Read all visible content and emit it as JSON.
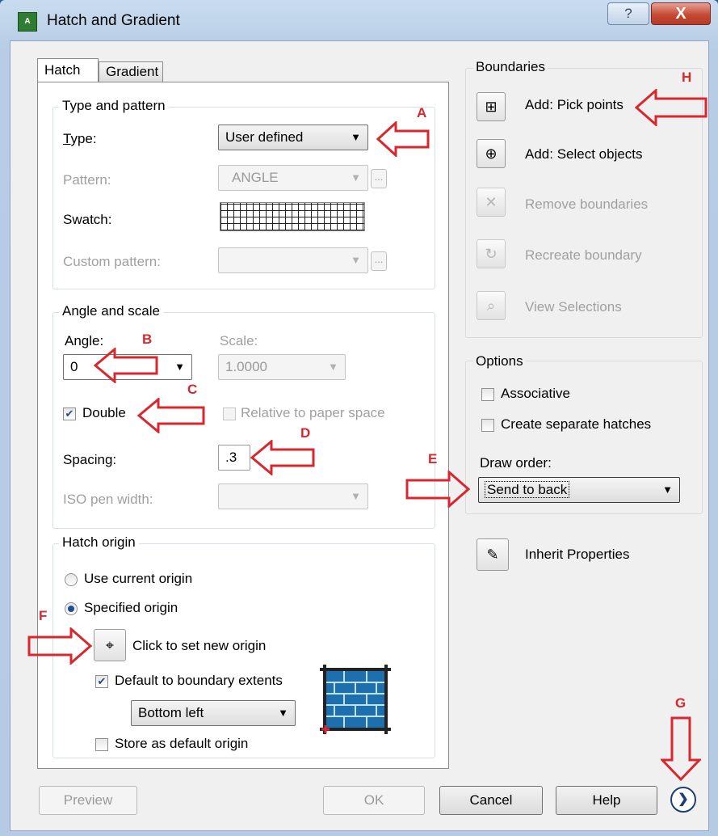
{
  "window": {
    "title": "Hatch and Gradient",
    "help_glyph": "?",
    "close_glyph": "X",
    "app_icon": "AutoCAD hatch icon"
  },
  "tabs": {
    "hatch": "Hatch",
    "gradient": "Gradient"
  },
  "type_and_pattern": {
    "title": "Type and pattern",
    "type_label": "Type:",
    "type_value": "User defined",
    "pattern_label": "Pattern:",
    "pattern_value": "ANGLE",
    "swatch_label": "Swatch:",
    "custom_pattern_label": "Custom pattern:",
    "custom_pattern_value": "",
    "ellipsis": "..."
  },
  "angle_and_scale": {
    "title": "Angle and scale",
    "angle_label": "Angle:",
    "angle_value": "0",
    "scale_label": "Scale:",
    "scale_value": "1.0000",
    "double_label": "Double",
    "double_checked": true,
    "relative_label": "Relative to paper space",
    "relative_checked": false,
    "spacing_label": "Spacing:",
    "spacing_value": ".3",
    "iso_label": "ISO pen width:",
    "iso_value": ""
  },
  "hatch_origin": {
    "title": "Hatch origin",
    "use_current": "Use current origin",
    "specified": "Specified origin",
    "click_set": "Click to set new origin",
    "default_extents": "Default to boundary extents",
    "default_extents_checked": true,
    "position_value": "Bottom left",
    "store_default": "Store as default origin",
    "store_default_checked": false
  },
  "boundaries": {
    "title": "Boundaries",
    "pick_points": "Add: Pick points",
    "select_objects": "Add: Select objects",
    "remove": "Remove boundaries",
    "recreate": "Recreate boundary",
    "view": "View Selections"
  },
  "options": {
    "title": "Options",
    "associative": "Associative",
    "associative_checked": false,
    "separate": "Create separate hatches",
    "separate_checked": false,
    "draw_order_label": "Draw order:",
    "draw_order_value": "Send to back"
  },
  "inherit": "Inherit Properties",
  "footer": {
    "preview": "Preview",
    "ok": "OK",
    "cancel": "Cancel",
    "help": "Help",
    "more_glyph": "❯"
  },
  "annotations": {
    "A": "A",
    "B": "B",
    "C": "C",
    "D": "D",
    "E": "E",
    "F": "F",
    "G": "G",
    "H": "H"
  },
  "colors": {
    "annotation_red": "#d7282f",
    "title_bar": "#c9dcef",
    "dialog_bg": "#f0f0f0"
  }
}
